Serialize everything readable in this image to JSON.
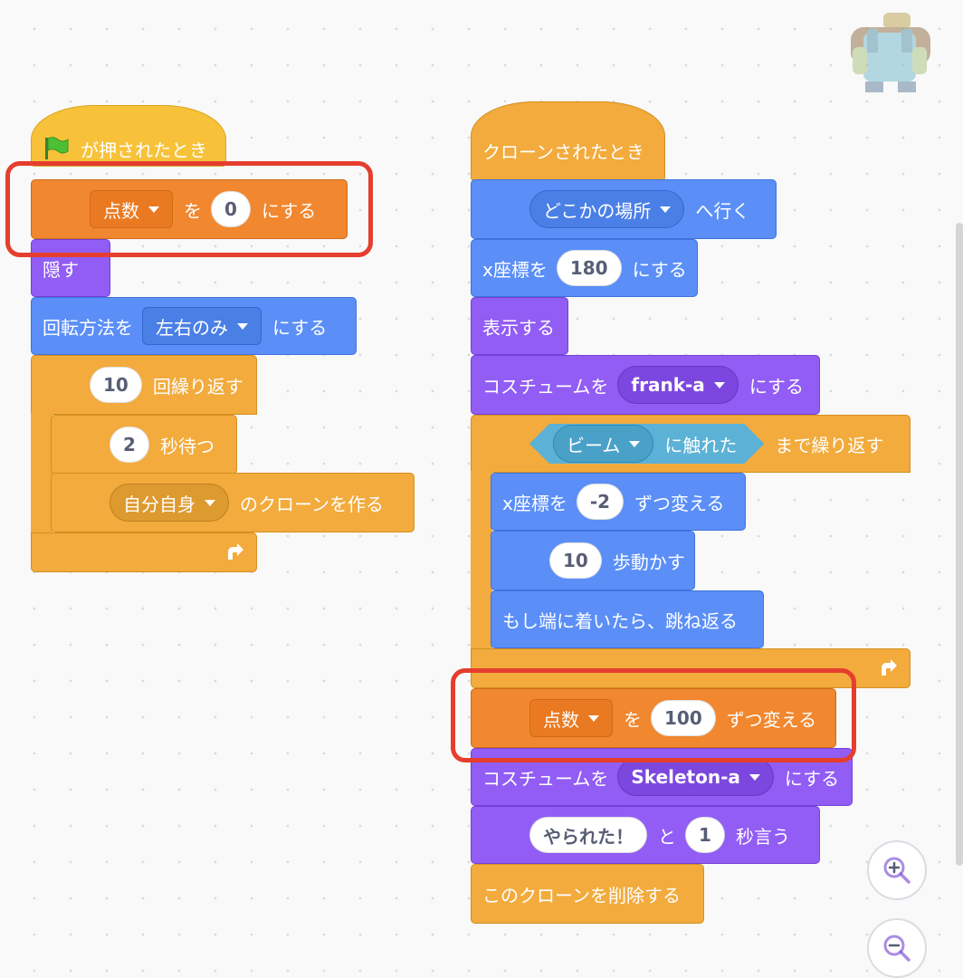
{
  "script_left": {
    "hat": "が押されたとき",
    "set_var": {
      "var": "点数",
      "label_wo": "を",
      "value": "0",
      "label_end": "にする"
    },
    "hide": "隠す",
    "rotation": {
      "label": "回転方法を",
      "option": "左右のみ",
      "label_end": "にする"
    },
    "repeat": {
      "count": "10",
      "label": "回繰り返す"
    },
    "wait": {
      "secs": "2",
      "label": "秒待つ"
    },
    "clone": {
      "target": "自分自身",
      "label": "のクローンを作る"
    }
  },
  "script_right": {
    "hat": "クローンされたとき",
    "goto": {
      "target": "どこかの場所",
      "label": "へ行く"
    },
    "set_x": {
      "label": "x座標を",
      "value": "180",
      "label_end": "にする"
    },
    "show": "表示する",
    "costume1": {
      "label": "コスチュームを",
      "costume": "frank-a",
      "label_end": "にする"
    },
    "repeat_until": {
      "sprite": "ビーム",
      "touch_label": "に触れた",
      "label": "まで繰り返す"
    },
    "change_x": {
      "label": "x座標を",
      "value": "-2",
      "label_end": "ずつ変える"
    },
    "move": {
      "steps": "10",
      "label": "歩動かす"
    },
    "bounce": "もし端に着いたら、跳ね返る",
    "change_var": {
      "var": "点数",
      "label_wo": "を",
      "value": "100",
      "label_end": "ずつ変える"
    },
    "costume2": {
      "label": "コスチュームを",
      "costume": "Skeleton-a",
      "label_end": "にする"
    },
    "say": {
      "text": "やられた！",
      "label_to": "と",
      "secs": "1",
      "label_end": "秒言う"
    },
    "delete_clone": "このクローンを削除する"
  },
  "zoom": {
    "in_icon": "zoom-in-icon",
    "out_icon": "zoom-out-icon"
  },
  "colors": {
    "events": "#f7c23a",
    "control": "#f2ab3c",
    "variables": "#f1872f",
    "motion": "#5b8ff7",
    "looks": "#925df5",
    "sensing": "#5cb1d6",
    "highlight": "#e53e2e"
  }
}
